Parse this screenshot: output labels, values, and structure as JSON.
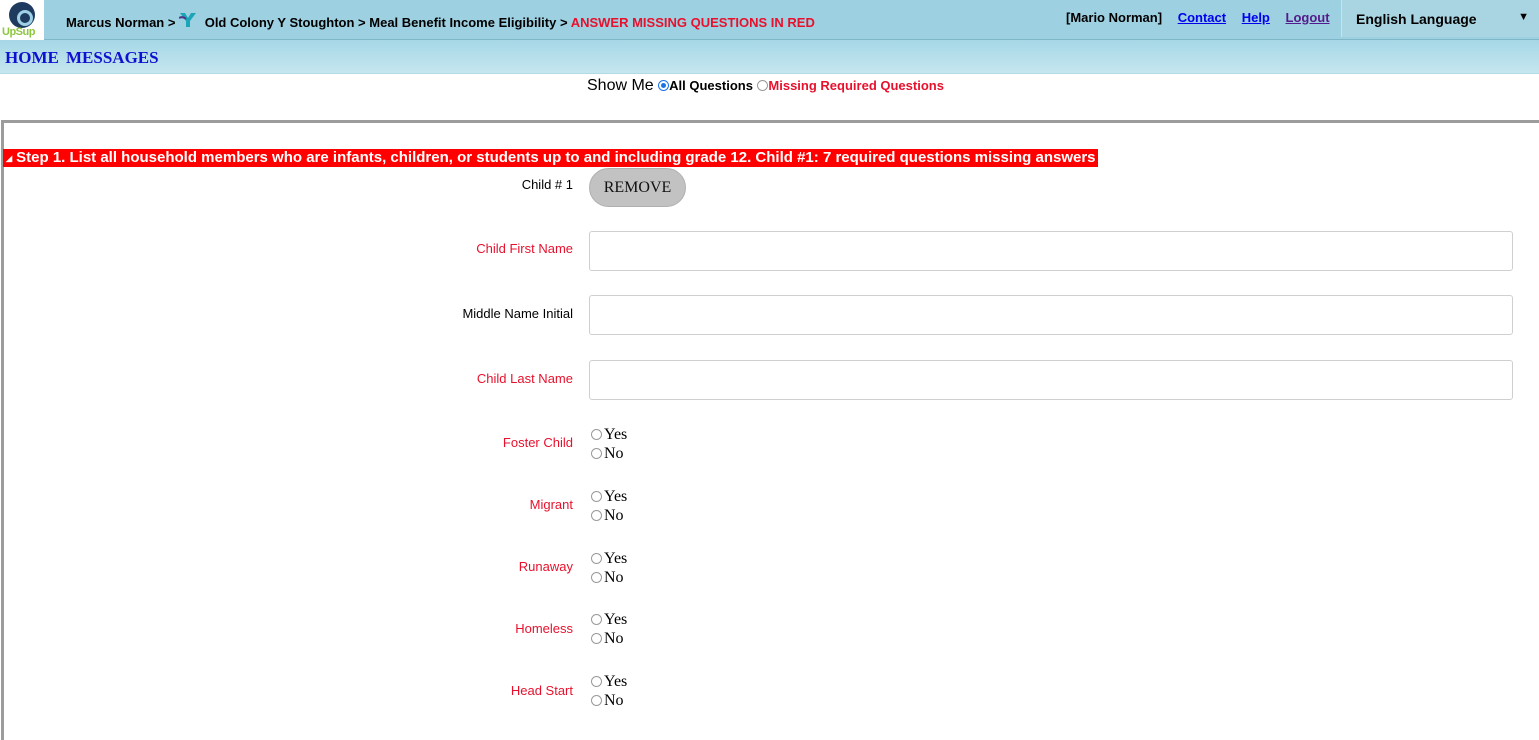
{
  "logo": {
    "text_a": "Up",
    "text_b": "Sup"
  },
  "breadcrumb": {
    "user": "Marcus Norman >",
    "org": "Old Colony Y Stoughton >",
    "form": "Meal Benefit Income Eligibility >",
    "instruction": "ANSWER MISSING QUESTIONS IN RED"
  },
  "header": {
    "account": "[Mario Norman]",
    "contact": "Contact",
    "help": "Help",
    "logout": "Logout",
    "language": "English Language"
  },
  "nav": {
    "home": "HOME",
    "messages": "MESSAGES"
  },
  "filter": {
    "label": "Show Me",
    "all": "All Questions",
    "missing": "Missing Required Questions",
    "selected": "All Questions"
  },
  "step": {
    "title": "Step 1. List all household members who are infants, children, or students up to and including grade 12. Child #1: 7 required questions missing answers"
  },
  "child": {
    "label": "Child # 1",
    "remove": "REMOVE"
  },
  "fields": {
    "first_name": {
      "label": "Child First Name",
      "value": ""
    },
    "middle_initial": {
      "label": "Middle Name Initial",
      "value": ""
    },
    "last_name": {
      "label": "Child Last Name",
      "value": ""
    }
  },
  "questions": [
    {
      "label": "Foster Child",
      "yes": "Yes",
      "no": "No"
    },
    {
      "label": "Migrant",
      "yes": "Yes",
      "no": "No"
    },
    {
      "label": "Runaway",
      "yes": "Yes",
      "no": "No"
    },
    {
      "label": "Homeless",
      "yes": "Yes",
      "no": "No"
    },
    {
      "label": "Head Start",
      "yes": "Yes",
      "no": "No"
    }
  ],
  "colors": {
    "required": "#e8112d",
    "header_bg": "#9dd0e0",
    "link": "#0000ee"
  }
}
